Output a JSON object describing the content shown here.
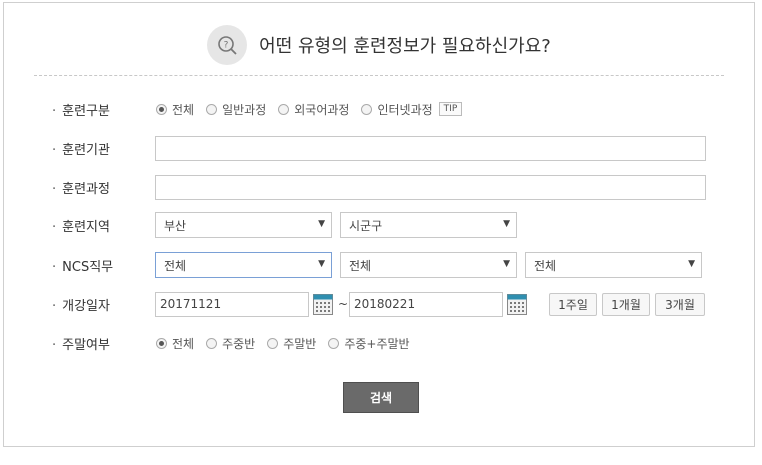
{
  "header": {
    "title": "어떤 유형의 훈련정보가 필요하신가요?",
    "icon": "search-question-icon"
  },
  "form": {
    "training_type": {
      "label": "훈련구분",
      "options": [
        "전체",
        "일반과정",
        "외국어과정",
        "인터넷과정"
      ],
      "selected": "전체",
      "tip_label": "TIP"
    },
    "institution": {
      "label": "훈련기관",
      "value": ""
    },
    "course": {
      "label": "훈련과정",
      "value": ""
    },
    "region": {
      "label": "훈련지역",
      "city": "부산",
      "district": "시군구"
    },
    "ncs": {
      "label": "NCS직무",
      "level1": "전체",
      "level2": "전체",
      "level3": "전체"
    },
    "start_date": {
      "label": "개강일자",
      "from": "20171121",
      "separator": "~",
      "to": "20180221",
      "period_buttons": [
        "1주일",
        "1개월",
        "3개월"
      ]
    },
    "weekend": {
      "label": "주말여부",
      "options": [
        "전체",
        "주중반",
        "주말반",
        "주중+주말반"
      ],
      "selected": "전체"
    }
  },
  "actions": {
    "search_label": "검색"
  },
  "colors": {
    "accent": "#6a6a6a",
    "border": "#c8c8c8",
    "focus": "#7aa0d6"
  }
}
